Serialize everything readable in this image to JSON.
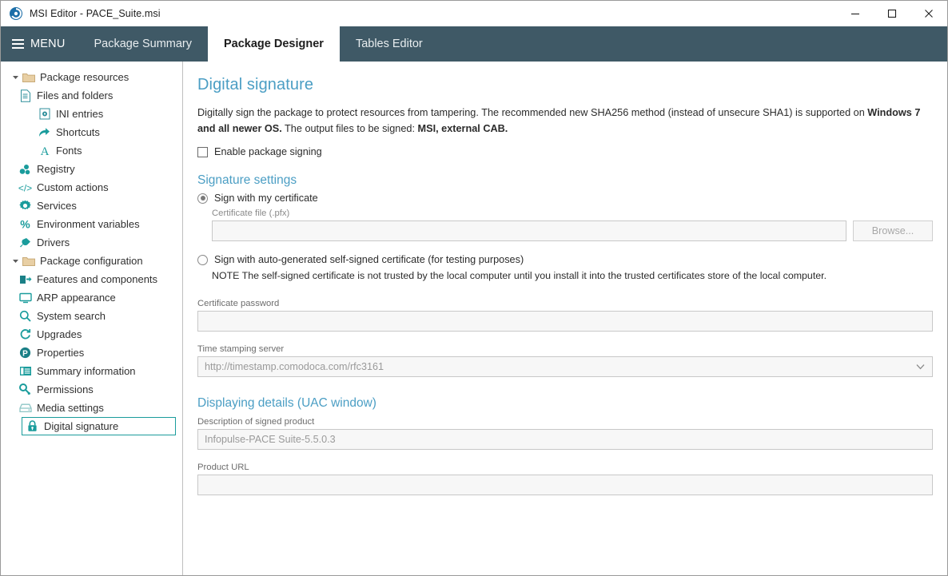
{
  "window": {
    "title": "MSI Editor - PACE_Suite.msi",
    "app_icon": "msi-editor-logo-icon",
    "controls": {
      "minimize": "minimize-icon",
      "maximize": "maximize-icon",
      "close": "close-icon"
    }
  },
  "header": {
    "menu_label": "MENU",
    "menu_icon": "hamburger-icon",
    "tabs": [
      {
        "label": "Package Summary",
        "active": false
      },
      {
        "label": "Package Designer",
        "active": true
      },
      {
        "label": "Tables Editor",
        "active": false
      }
    ],
    "background": "#3f5966"
  },
  "sidebar": {
    "items": [
      {
        "label": "Package resources",
        "level": 1,
        "icon": "folder-icon",
        "twisty": "chevron-down-icon",
        "selected": false
      },
      {
        "label": "Files and folders",
        "level": 2,
        "icon": "document-icon",
        "twisty": "",
        "selected": false
      },
      {
        "label": "INI entries",
        "level": 3,
        "icon": "ini-file-icon",
        "twisty": "",
        "selected": false
      },
      {
        "label": "Shortcuts",
        "level": 3,
        "icon": "shortcut-arrow-icon",
        "twisty": "",
        "selected": false
      },
      {
        "label": "Fonts",
        "level": 3,
        "icon": "font-letter-a-icon",
        "twisty": "",
        "selected": false
      },
      {
        "label": "Registry",
        "level": 2,
        "icon": "registry-blocks-icon",
        "twisty": "",
        "selected": false
      },
      {
        "label": "Custom actions",
        "level": 2,
        "icon": "code-brackets-icon",
        "twisty": "",
        "selected": false
      },
      {
        "label": "Services",
        "level": 2,
        "icon": "gear-icon",
        "twisty": "",
        "selected": false
      },
      {
        "label": "Environment variables",
        "level": 2,
        "icon": "percent-icon",
        "twisty": "",
        "selected": false
      },
      {
        "label": "Drivers",
        "level": 2,
        "icon": "plug-icon",
        "twisty": "",
        "selected": false
      },
      {
        "label": "Package configuration",
        "level": 1,
        "icon": "folder-icon",
        "twisty": "chevron-down-icon",
        "selected": false
      },
      {
        "label": "Features and components",
        "level": 2,
        "icon": "features-icon",
        "twisty": "",
        "selected": false
      },
      {
        "label": "ARP appearance",
        "level": 2,
        "icon": "monitor-icon",
        "twisty": "",
        "selected": false
      },
      {
        "label": "System search",
        "level": 2,
        "icon": "search-icon",
        "twisty": "",
        "selected": false
      },
      {
        "label": "Upgrades",
        "level": 2,
        "icon": "refresh-icon",
        "twisty": "",
        "selected": false
      },
      {
        "label": "Properties",
        "level": 2,
        "icon": "circle-p-icon",
        "twisty": "",
        "selected": false
      },
      {
        "label": "Summary information",
        "level": 2,
        "icon": "list-panel-icon",
        "twisty": "",
        "selected": false
      },
      {
        "label": "Permissions",
        "level": 2,
        "icon": "key-icon",
        "twisty": "",
        "selected": false
      },
      {
        "label": "Media settings",
        "level": 2,
        "icon": "media-disc-icon",
        "twisty": "",
        "selected": false
      },
      {
        "label": "Digital signature",
        "level": 2,
        "icon": "lock-icon",
        "twisty": "",
        "selected": true
      }
    ],
    "selection_color": "#1a9c9c"
  },
  "main": {
    "page_title": "Digital signature",
    "intro": {
      "part1": "Digitally sign the package to protect resources from tampering. The recommended new SHA256 method (instead of unsecure SHA1) is supported on ",
      "bold1": "Windows 7 and all newer OS.",
      "part2": " The output files to be signed: ",
      "bold2": "MSI, external CAB."
    },
    "enable_signing": {
      "label": "Enable package signing",
      "checked": false
    },
    "signature_settings": {
      "title": "Signature settings",
      "option_own": {
        "label": "Sign with my certificate",
        "selected": true
      },
      "certificate_file": {
        "label": "Certificate file (.pfx)",
        "value": "",
        "placeholder": ""
      },
      "browse_button": "Browse...",
      "option_self_signed": {
        "label": "Sign with auto-generated self-signed certificate (for testing purposes)",
        "selected": false
      },
      "note": "NOTE The self-signed certificate is not trusted by the local computer until you install it into the trusted certificates store of the local computer.",
      "certificate_password": {
        "label": "Certificate password",
        "value": "",
        "reveal_icon": "eye-icon"
      },
      "timestamp_server": {
        "label": "Time stamping server",
        "value": "http://timestamp.comodoca.com/rfc3161",
        "caret_icon": "chevron-down-icon"
      }
    },
    "displaying_details": {
      "title": "Displaying details (UAC window)",
      "description": {
        "label": "Description of signed product",
        "value": "Infopulse-PACE Suite-5.5.0.3"
      },
      "product_url": {
        "label": "Product URL",
        "value": ""
      }
    },
    "accent_color": "#4b9ec4"
  }
}
